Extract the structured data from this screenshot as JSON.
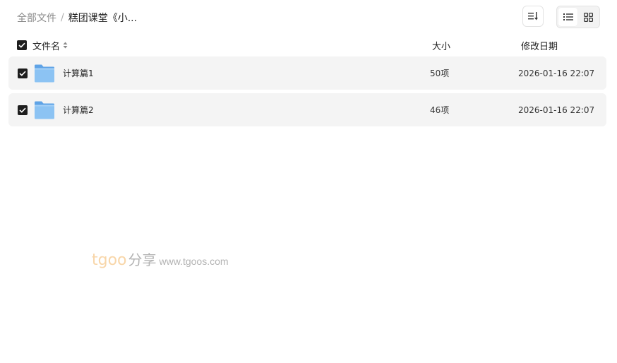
{
  "breadcrumb": {
    "root": "全部文件",
    "separator": "/",
    "current": "糕团课堂《小..."
  },
  "toolbar": {
    "sort_icon": "sort-list-icon",
    "list_view_icon": "list-view-icon",
    "grid_view_icon": "grid-view-icon"
  },
  "table": {
    "headers": {
      "name": "文件名",
      "size": "大小",
      "date": "修改日期"
    },
    "rows": [
      {
        "name": "计算篇1",
        "size": "50项",
        "date": "2026-01-16 22:07",
        "checked": true
      },
      {
        "name": "计算篇2",
        "size": "46项",
        "date": "2026-01-16 22:07",
        "checked": true
      }
    ]
  },
  "watermark": {
    "brand": "tgoo",
    "share": "分享",
    "url": "www.tgoos.com"
  },
  "colors": {
    "row_bg": "#f4f4f4",
    "checkbox": "#1e1e1e",
    "folder": "#7fb8ee"
  }
}
